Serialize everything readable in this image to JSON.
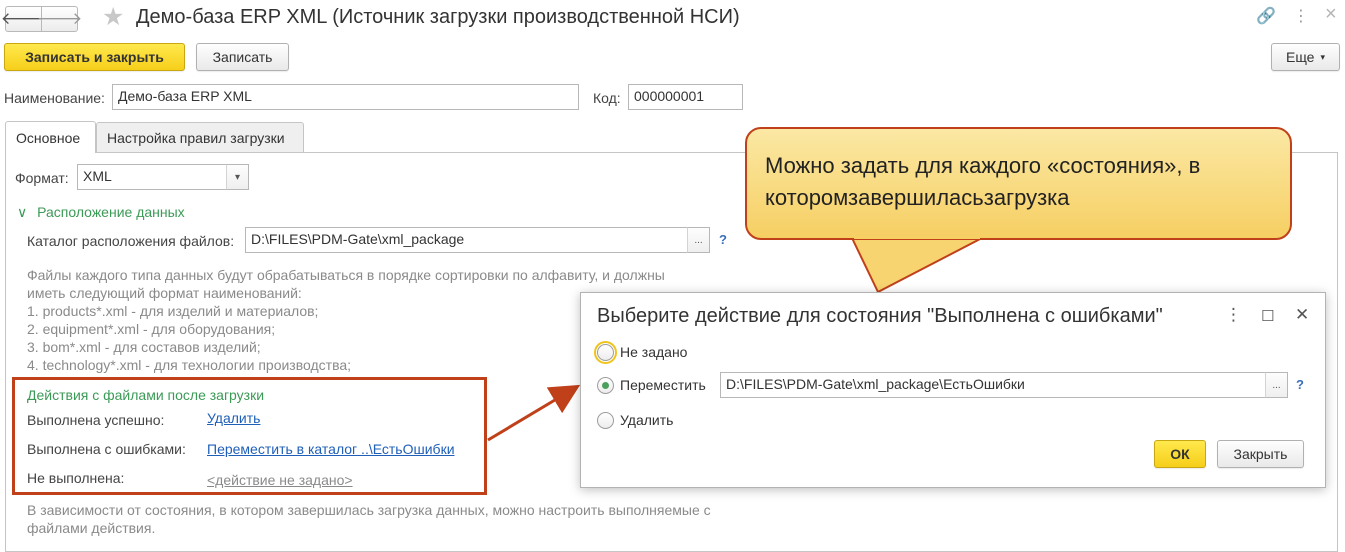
{
  "window": {
    "title": "Демо-база ERP XML (Источник загрузки производственной НСИ)",
    "back_icon": "arrow-left-icon",
    "forward_icon": "arrow-right-icon",
    "favorite_icon": "star-icon",
    "link_icon": "link-icon",
    "menu_icon": "more-vertical-icon",
    "close_icon": "close-icon",
    "glyphs": {
      "back": "🡐",
      "forward": "🡒",
      "star": "★",
      "link": "🔗",
      "more": "⋮",
      "close": "×"
    }
  },
  "toolbar": {
    "save_close_label": "Записать и закрыть",
    "save_label": "Записать",
    "more_label": "Еще",
    "more_caret": "▾"
  },
  "fields": {
    "name_label": "Наименование:",
    "name_value": "Демо-база ERP XML",
    "code_label": "Код:",
    "code_value": "000000001"
  },
  "tabs": [
    {
      "label": "Основное",
      "active": true
    },
    {
      "label": "Настройка правил загрузки",
      "active": false
    }
  ],
  "main": {
    "format_label": "Формат:",
    "format_value": "XML",
    "format_caret": "▾",
    "location_group_caret": "∨",
    "location_group_title": "Расположение данных",
    "catalog_label": "Каталог расположения файлов:",
    "catalog_value": "D:\\FILES\\PDM-Gate\\xml_package",
    "ellipsis": "...",
    "help": "?",
    "hint_lines": [
      "Файлы каждого типа данных будут обрабатываться в порядке сортировки по алфавиту, и должны",
      "иметь следующий формат наименований:",
      "1. products*.xml - для изделий и материалов;",
      "2. equipment*.xml - для оборудования;",
      "3. bom*.xml - для составов изделий;",
      "4. technology*.xml - для технологии производства;"
    ],
    "actions_title": "Действия с файлами после загрузки",
    "actions": [
      {
        "label": "Выполнена успешно:",
        "value": "Удалить",
        "muted": false
      },
      {
        "label": "Выполнена с ошибками:",
        "value": "Переместить в каталог ..\\ЕстьОшибки",
        "muted": false
      },
      {
        "label": "Не выполнена:",
        "value": "<действие не задано>",
        "muted": true
      }
    ],
    "bottom_hint_lines": [
      "В зависимости от состояния, в котором завершилась загрузка данных, можно настроить выполняемые с",
      "файлами действия."
    ]
  },
  "callout": {
    "text": "Можно задать для каждого «состояния», в которомзавершиласьзагрузка"
  },
  "dialog": {
    "title": "Выберите действие для состояния \"Выполнена с ошибками\"",
    "more_glyph": "⋮",
    "maximize_glyph": "☐",
    "close_glyph": "✕",
    "options": [
      {
        "label": "Не задано",
        "checked": false,
        "focused": true
      },
      {
        "label": "Переместить",
        "checked": true,
        "focused": false
      },
      {
        "label": "Удалить",
        "checked": false,
        "focused": false
      }
    ],
    "path_value": "D:\\FILES\\PDM-Gate\\xml_package\\ЕстьОшибки",
    "ellipsis": "...",
    "help": "?",
    "ok_label": "ОК",
    "close_label": "Закрыть"
  },
  "colors": {
    "accent_yellow": "#f6cf1a",
    "group_green": "#3c9a57",
    "link_blue": "#1f5fb8",
    "annotation_red": "#c0401a",
    "callout_fill": "#f6cf63"
  }
}
